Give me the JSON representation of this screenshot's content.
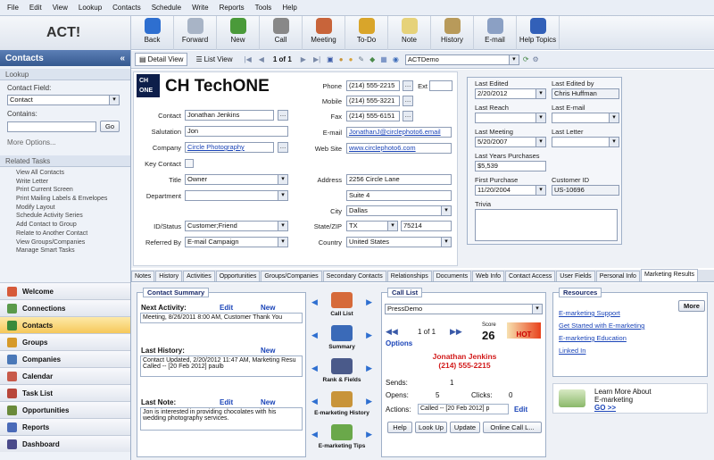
{
  "menu": [
    "File",
    "Edit",
    "View",
    "Lookup",
    "Contacts",
    "Schedule",
    "Write",
    "Reports",
    "Tools",
    "Help"
  ],
  "app_title": "ACT!",
  "toolbar": [
    {
      "label": "Back",
      "icon": "back-arrow-icon",
      "color": "#2e6fd0"
    },
    {
      "label": "Forward",
      "icon": "forward-arrow-icon",
      "color": "#a8b4c6"
    },
    {
      "label": "New",
      "icon": "new-contact-icon",
      "color": "#4a9a3a"
    },
    {
      "label": "Call",
      "icon": "phone-icon",
      "color": "#888"
    },
    {
      "label": "Meeting",
      "icon": "meeting-icon",
      "color": "#c8643a"
    },
    {
      "label": "To-Do",
      "icon": "todo-icon",
      "color": "#d9a52a"
    },
    {
      "label": "Note",
      "icon": "note-icon",
      "color": "#e6d27a"
    },
    {
      "label": "History",
      "icon": "history-icon",
      "color": "#b89a5a"
    },
    {
      "label": "E-mail",
      "icon": "email-icon",
      "color": "#8ba0c4"
    },
    {
      "label": "Help Topics",
      "icon": "help-icon",
      "color": "#3260b8"
    }
  ],
  "sidebar": {
    "title": "Contacts",
    "lookup_header": "Lookup",
    "contact_field_label": "Contact Field:",
    "contact_field_value": "Contact",
    "contains_label": "Contains:",
    "go_label": "Go",
    "more_options": "More Options...",
    "related_tasks_header": "Related Tasks",
    "tasks": [
      "View All Contacts",
      "Write Letter",
      "Print Current Screen",
      "Print Mailing Labels & Envelopes",
      "Modify Layout",
      "Schedule Activity Series",
      "Add Contact to Group",
      "Relate to Another Contact",
      "View Groups/Companies",
      "Manage Smart Tasks"
    ],
    "nav": [
      "Welcome",
      "Connections",
      "Contacts",
      "Groups",
      "Companies",
      "Calendar",
      "Task List",
      "Opportunities",
      "Reports",
      "Dashboard"
    ],
    "nav_colors": [
      "#d65a3a",
      "#5a9a4a",
      "#3a8a3a",
      "#d69a2a",
      "#4a78b8",
      "#c85a4a",
      "#b8463a",
      "#6a8a3a",
      "#4a6ab8",
      "#4a4a8a"
    ]
  },
  "viewbar": {
    "detail_view": "Detail View",
    "list_view": "List View",
    "record": "1 of 1",
    "layout": "ACTDemo"
  },
  "contact": {
    "company_logo_small": "CH ONE",
    "company_logo_text": "CH TechONE",
    "contact_label": "Contact",
    "contact": "Jonathan Jenkins",
    "salutation_label": "Salutation",
    "salutation": "Jon",
    "company_label": "Company",
    "company": "Circle Photography",
    "key_contact_label": "Key Contact",
    "title_label": "Title",
    "title": "Owner",
    "department_label": "Department",
    "department": "",
    "id_status_label": "ID/Status",
    "id_status": "Customer;Friend",
    "referred_by_label": "Referred By",
    "referred_by": "E-mail Campaign",
    "phone_label": "Phone",
    "phone": "(214) 555-2215",
    "ext_label": "Ext",
    "mobile_label": "Mobile",
    "mobile": "(214) 555-3221",
    "fax_label": "Fax",
    "fax": "(214) 555-6151",
    "email_label": "E-mail",
    "email": "JonathanJ@circlephoto6.email",
    "website_label": "Web Site",
    "website": "www.circlephoto6.com",
    "address_label": "Address",
    "address1": "2256 Circle Lane",
    "address2": "Suite 4",
    "city_label": "City",
    "city": "Dallas",
    "state_zip_label": "State/ZIP",
    "state": "TX",
    "zip": "75214",
    "country_label": "Country",
    "country": "United States"
  },
  "right_fields": {
    "last_edited_label": "Last Edited",
    "last_edited": "2/20/2012",
    "last_edited_by_label": "Last Edited by",
    "last_edited_by": "Chris Huffman",
    "last_reach_label": "Last Reach",
    "last_reach": "",
    "last_email_label": "Last E-mail",
    "last_email": "",
    "last_meeting_label": "Last Meeting",
    "last_meeting": "5/20/2007",
    "last_letter_label": "Last Letter",
    "last_letter": "",
    "last_years_purchases_label": "Last Years Purchases",
    "last_years_purchases": "$5,539",
    "first_purchase_label": "First Purchase",
    "first_purchase": "11/20/2004",
    "customer_id_label": "Customer ID",
    "customer_id": "US-10696",
    "trivia_label": "Trivia",
    "trivia": ""
  },
  "tabs": [
    "Notes",
    "History",
    "Activities",
    "Opportunities",
    "Groups/Companies",
    "Secondary Contacts",
    "Relationships",
    "Documents",
    "Web Info",
    "Contact Access",
    "User Fields",
    "Personal Info",
    "Marketing Results"
  ],
  "contact_summary": {
    "title": "Contact Summary",
    "next_activity_label": "Next Activity:",
    "edit": "Edit",
    "new": "New",
    "next_activity": "Meeting, 8/26/2011 8:00 AM, Customer Thank You",
    "last_history_label": "Last History:",
    "last_history_1": "Contact Updated, 2/20/2012 11:47 AM, Marketing Resu",
    "last_history_2": "Called -- [20 Feb 2012] paulb",
    "last_note_label": "Last Note:",
    "last_note": "Jon is interested in providing chocolates with his wedding photography services."
  },
  "middle_nav": [
    "Call List",
    "Summary",
    "Rank & Fields",
    "E-marketing History",
    "E-marketing Tips"
  ],
  "call_list": {
    "title": "Call List",
    "list": "PressDemo",
    "page": "1 of 1",
    "score_label": "Score",
    "score": "26",
    "hot": "HOT",
    "options": "Options",
    "name": "Jonathan Jenkins",
    "phone": "(214) 555-2215",
    "sends_label": "Sends:",
    "sends": "1",
    "opens_label": "Opens:",
    "opens": "5",
    "clicks_label": "Clicks:",
    "clicks": "0",
    "actions_label": "Actions:",
    "actions": "Called -- [20 Feb 2012] p",
    "edit": "Edit",
    "buttons": [
      "Help",
      "Look Up",
      "Update",
      "Online Call L..."
    ]
  },
  "resources": {
    "title": "Resources",
    "more": "More",
    "links": [
      "E-marketing Support",
      "Get Started with E-marketing",
      "E-marketing Education",
      "Linked In"
    ],
    "promo_1": "Learn More About",
    "promo_2": "E-marketing",
    "promo_go": "GO >>"
  }
}
